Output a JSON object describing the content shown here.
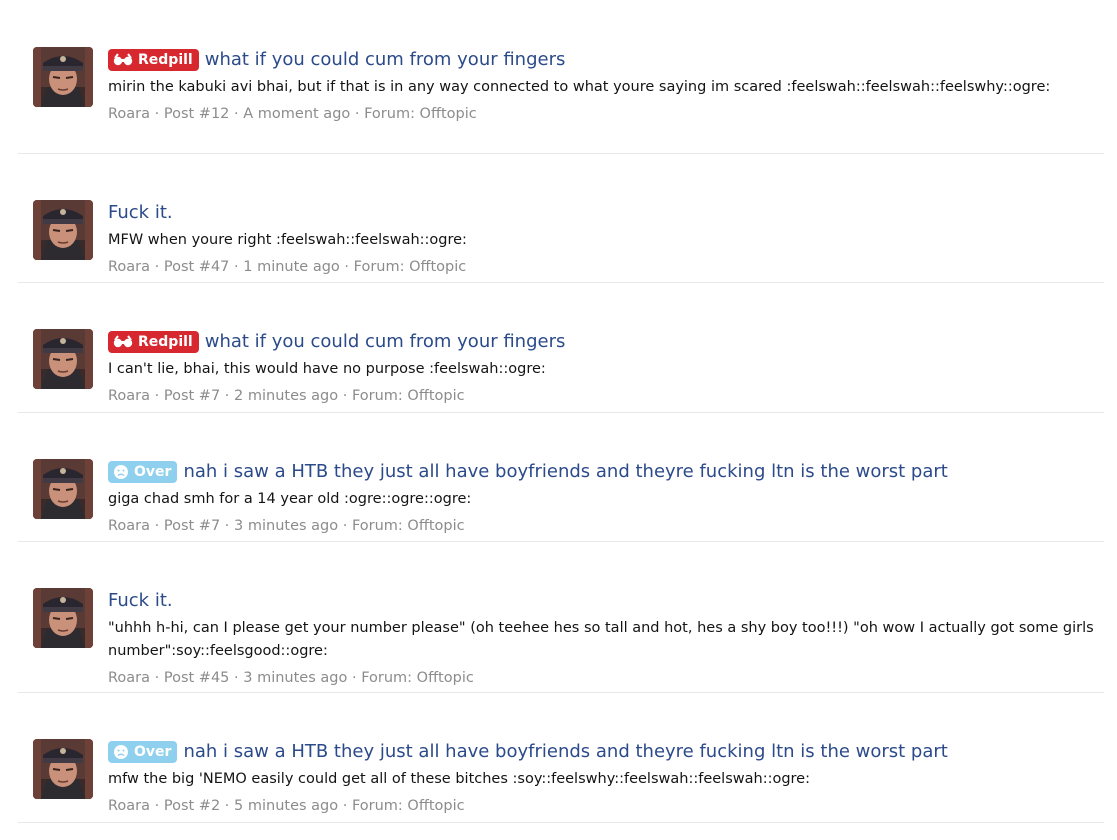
{
  "colors": {
    "title": "#2b4a8a",
    "redpill_badge": "#d7282f",
    "over_badge": "#8fd0ee",
    "meta": "#8c8c8c"
  },
  "results": [
    {
      "badge": {
        "label": "Redpill",
        "icon": "glasses-icon",
        "color": "#d7282f"
      },
      "title": "what if you could cum from your fingers",
      "snippet": "mirin the kabuki avi bhai, but if that is in any way connected to what youre saying im scared :feelswah::feelswah::feelswhy::ogre:",
      "author": "Roara",
      "post": "Post #12",
      "time": "A moment ago",
      "forum": "Forum: Offtopic"
    },
    {
      "title": "Fuck it.",
      "snippet": "MFW when youre right :feelswah::feelswah::ogre:",
      "author": "Roara",
      "post": "Post #47",
      "time": "1 minute ago",
      "forum": "Forum: Offtopic"
    },
    {
      "badge": {
        "label": "Redpill",
        "icon": "glasses-icon",
        "color": "#d7282f"
      },
      "title": "what if you could cum from your fingers",
      "snippet": "I can't lie, bhai, this would have no purpose :feelswah::ogre:",
      "author": "Roara",
      "post": "Post #7",
      "time": "2 minutes ago",
      "forum": "Forum: Offtopic"
    },
    {
      "badge": {
        "label": "Over",
        "icon": "sad-face-icon",
        "color": "#8fd0ee"
      },
      "title": "nah i saw a HTB they just all have boyfriends and theyre fucking ltn is the worst part",
      "snippet": "giga chad smh for a 14 year old :ogre::ogre::ogre:",
      "author": "Roara",
      "post": "Post #7",
      "time": "3 minutes ago",
      "forum": "Forum: Offtopic"
    },
    {
      "title": "Fuck it.",
      "snippet": "\"uhhh h-hi, can I please get your number please\" (oh teehee hes so tall and hot, hes a shy boy too!!!) \"oh wow I actually got some girls number\":soy::feelsgood::ogre:",
      "author": "Roara",
      "post": "Post #45",
      "time": "3 minutes ago",
      "forum": "Forum: Offtopic"
    },
    {
      "badge": {
        "label": "Over",
        "icon": "sad-face-icon",
        "color": "#8fd0ee"
      },
      "title": "nah i saw a HTB they just all have boyfriends and theyre fucking ltn is the worst part",
      "snippet": "mfw the big 'NEMO easily could get all of these bitches :soy::feelswhy::feelswah::feelswah::ogre:",
      "author": "Roara",
      "post": "Post #2",
      "time": "5 minutes ago",
      "forum": "Forum: Offtopic"
    }
  ]
}
